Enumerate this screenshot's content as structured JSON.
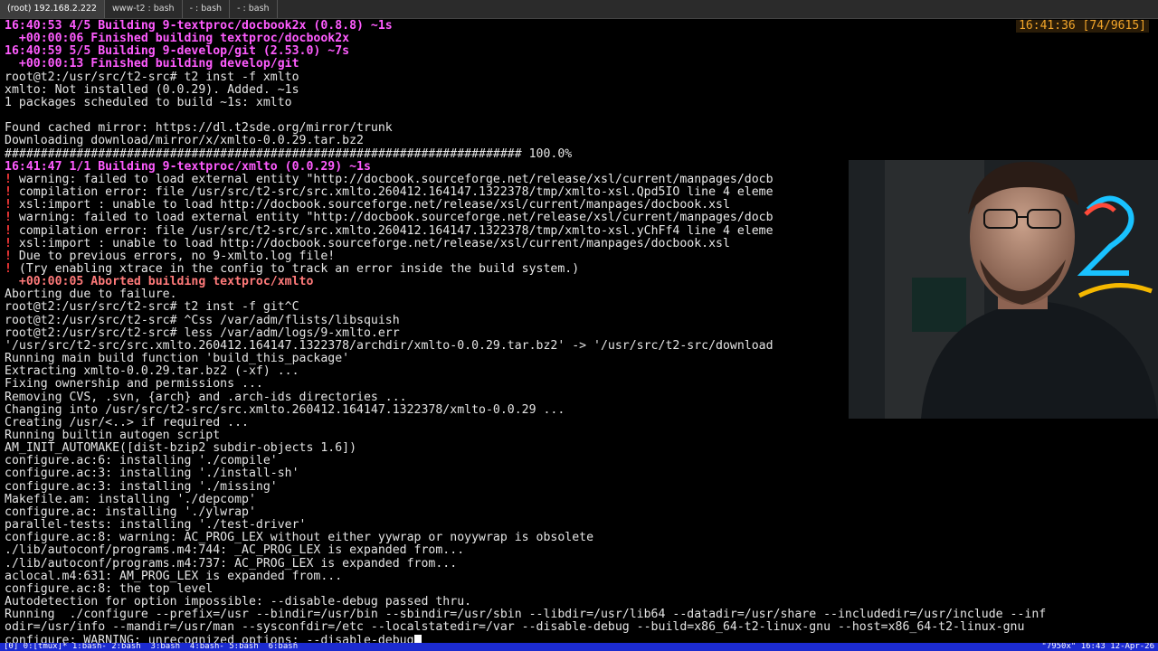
{
  "tabs": [
    {
      "label": "(root) 192.168.2.222"
    },
    {
      "label": "www-t2 : bash"
    },
    {
      "label": "- : bash"
    },
    {
      "label": "- : bash"
    }
  ],
  "clock": "16:41:36 [74/9615]",
  "terminal_lines": [
    {
      "text": "16:40:53 4/5 Building 9-textproc/docbook2x (0.8.8) ~1s",
      "style": "magenta"
    },
    {
      "text": "  +00:00:06 Finished building textproc/docbook2x",
      "style": "magenta"
    },
    {
      "text": "16:40:59 5/5 Building 9-develop/git (2.53.0) ~7s",
      "style": "magenta"
    },
    {
      "text": "  +00:00:13 Finished building develop/git",
      "style": "magenta"
    },
    {
      "text": "root@t2:/usr/src/t2-src# t2 inst -f xmlto",
      "style": "plain"
    },
    {
      "text": "xmlto: Not installed (0.0.29). Added. ~1s",
      "style": "plain"
    },
    {
      "text": "1 packages scheduled to build ~1s: xmlto",
      "style": "plain"
    },
    {
      "text": "",
      "style": "plain"
    },
    {
      "text": "Found cached mirror: https://dl.t2sde.org/mirror/trunk",
      "style": "plain"
    },
    {
      "text": "Downloading download/mirror/x/xmlto-0.0.29.tar.bz2",
      "style": "plain"
    },
    {
      "text": "######################################################################## 100.0%",
      "style": "plain"
    },
    {
      "text": "16:41:47 1/1 Building 9-textproc/xmlto (0.0.29) ~1s",
      "style": "magenta"
    },
    {
      "text": " warning: failed to load external entity \"http://docbook.sourceforge.net/release/xsl/current/manpages/docb",
      "style": "warn",
      "clip": true
    },
    {
      "text": " compilation error: file /usr/src/t2-src/src.xmlto.260412.164147.1322378/tmp/xmlto-xsl.Qpd5IO line 4 eleme",
      "style": "warn",
      "clip": true
    },
    {
      "text": " xsl:import : unable to load http://docbook.sourceforge.net/release/xsl/current/manpages/docbook.xsl",
      "style": "warn",
      "clip": true
    },
    {
      "text": " warning: failed to load external entity \"http://docbook.sourceforge.net/release/xsl/current/manpages/docb",
      "style": "warn",
      "clip": true
    },
    {
      "text": " compilation error: file /usr/src/t2-src/src.xmlto.260412.164147.1322378/tmp/xmlto-xsl.yChFf4 line 4 eleme",
      "style": "warn",
      "clip": true
    },
    {
      "text": " xsl:import : unable to load http://docbook.sourceforge.net/release/xsl/current/manpages/docbook.xsl",
      "style": "warn",
      "clip": true
    },
    {
      "text": " Due to previous errors, no 9-xmlto.log file!",
      "style": "warn"
    },
    {
      "text": " (Try enabling xtrace in the config to track an error inside the build system.)",
      "style": "warn"
    },
    {
      "text": "  +00:00:05 Aborted building textproc/xmlto",
      "style": "err"
    },
    {
      "text": "Aborting due to failure.",
      "style": "plain"
    },
    {
      "text": "root@t2:/usr/src/t2-src# t2 inst -f git^C",
      "style": "plain"
    },
    {
      "text": "root@t2:/usr/src/t2-src# ^Css /var/adm/flists/libsquish",
      "style": "plain"
    },
    {
      "text": "root@t2:/usr/src/t2-src# less /var/adm/logs/9-xmlto.err",
      "style": "plain"
    },
    {
      "text": "'/usr/src/t2-src/src.xmlto.260412.164147.1322378/archdir/xmlto-0.0.29.tar.bz2' -> '/usr/src/t2-src/download",
      "style": "plain",
      "clip": true
    },
    {
      "text": "Running main build function 'build_this_package'",
      "style": "plain"
    },
    {
      "text": "Extracting xmlto-0.0.29.tar.bz2 (-xf) ...",
      "style": "plain"
    },
    {
      "text": "Fixing ownership and permissions ...",
      "style": "plain"
    },
    {
      "text": "Removing CVS, .svn, {arch} and .arch-ids directories ...",
      "style": "plain"
    },
    {
      "text": "Changing into /usr/src/t2-src/src.xmlto.260412.164147.1322378/xmlto-0.0.29 ...",
      "style": "plain"
    },
    {
      "text": "Creating /usr/<..> if required ...",
      "style": "plain"
    },
    {
      "text": "Running builtin autogen script",
      "style": "plain"
    },
    {
      "text": "AM_INIT_AUTOMAKE([dist-bzip2 subdir-objects 1.6])",
      "style": "plain"
    },
    {
      "text": "configure.ac:6: installing './compile'",
      "style": "plain"
    },
    {
      "text": "configure.ac:3: installing './install-sh'",
      "style": "plain"
    },
    {
      "text": "configure.ac:3: installing './missing'",
      "style": "plain"
    },
    {
      "text": "Makefile.am: installing './depcomp'",
      "style": "plain"
    },
    {
      "text": "configure.ac: installing './ylwrap'",
      "style": "plain"
    },
    {
      "text": "parallel-tests: installing './test-driver'",
      "style": "plain"
    },
    {
      "text": "configure.ac:8: warning: AC_PROG_LEX without either yywrap or noyywrap is obsolete",
      "style": "plain"
    },
    {
      "text": "./lib/autoconf/programs.m4:744: _AC_PROG_LEX is expanded from...",
      "style": "plain"
    },
    {
      "text": "./lib/autoconf/programs.m4:737: AC_PROG_LEX is expanded from...",
      "style": "plain"
    },
    {
      "text": "aclocal.m4:631: AM_PROG_LEX is expanded from...",
      "style": "plain"
    },
    {
      "text": "configure.ac:8: the top level",
      "style": "plain"
    },
    {
      "text": "Autodetection for option impossible: --disable-debug passed thru.",
      "style": "plain"
    },
    {
      "text": "Running  ./configure --prefix=/usr --bindir=/usr/bin --sbindir=/usr/sbin --libdir=/usr/lib64 --datadir=/usr/share --includedir=/usr/include --inf",
      "style": "plain"
    },
    {
      "text": "odir=/usr/info --mandir=/usr/man --sysconfdir=/etc --localstatedir=/var --disable-debug --build=x86_64-t2-linux-gnu --host=x86_64-t2-linux-gnu",
      "style": "plain"
    },
    {
      "text": "configure: WARNING: unrecognized options: --disable-debug",
      "style": "plain",
      "cursor": true
    }
  ],
  "status_bar": {
    "left": "[0] 0:[tmux]* 1:bash- 2:bash  3:bash  4:bash- 5:bash  6:bash",
    "right": "\"7950x\" 16:43 12-Apr-26"
  },
  "icons": {
    "warn_marker": "exclamation-icon"
  }
}
